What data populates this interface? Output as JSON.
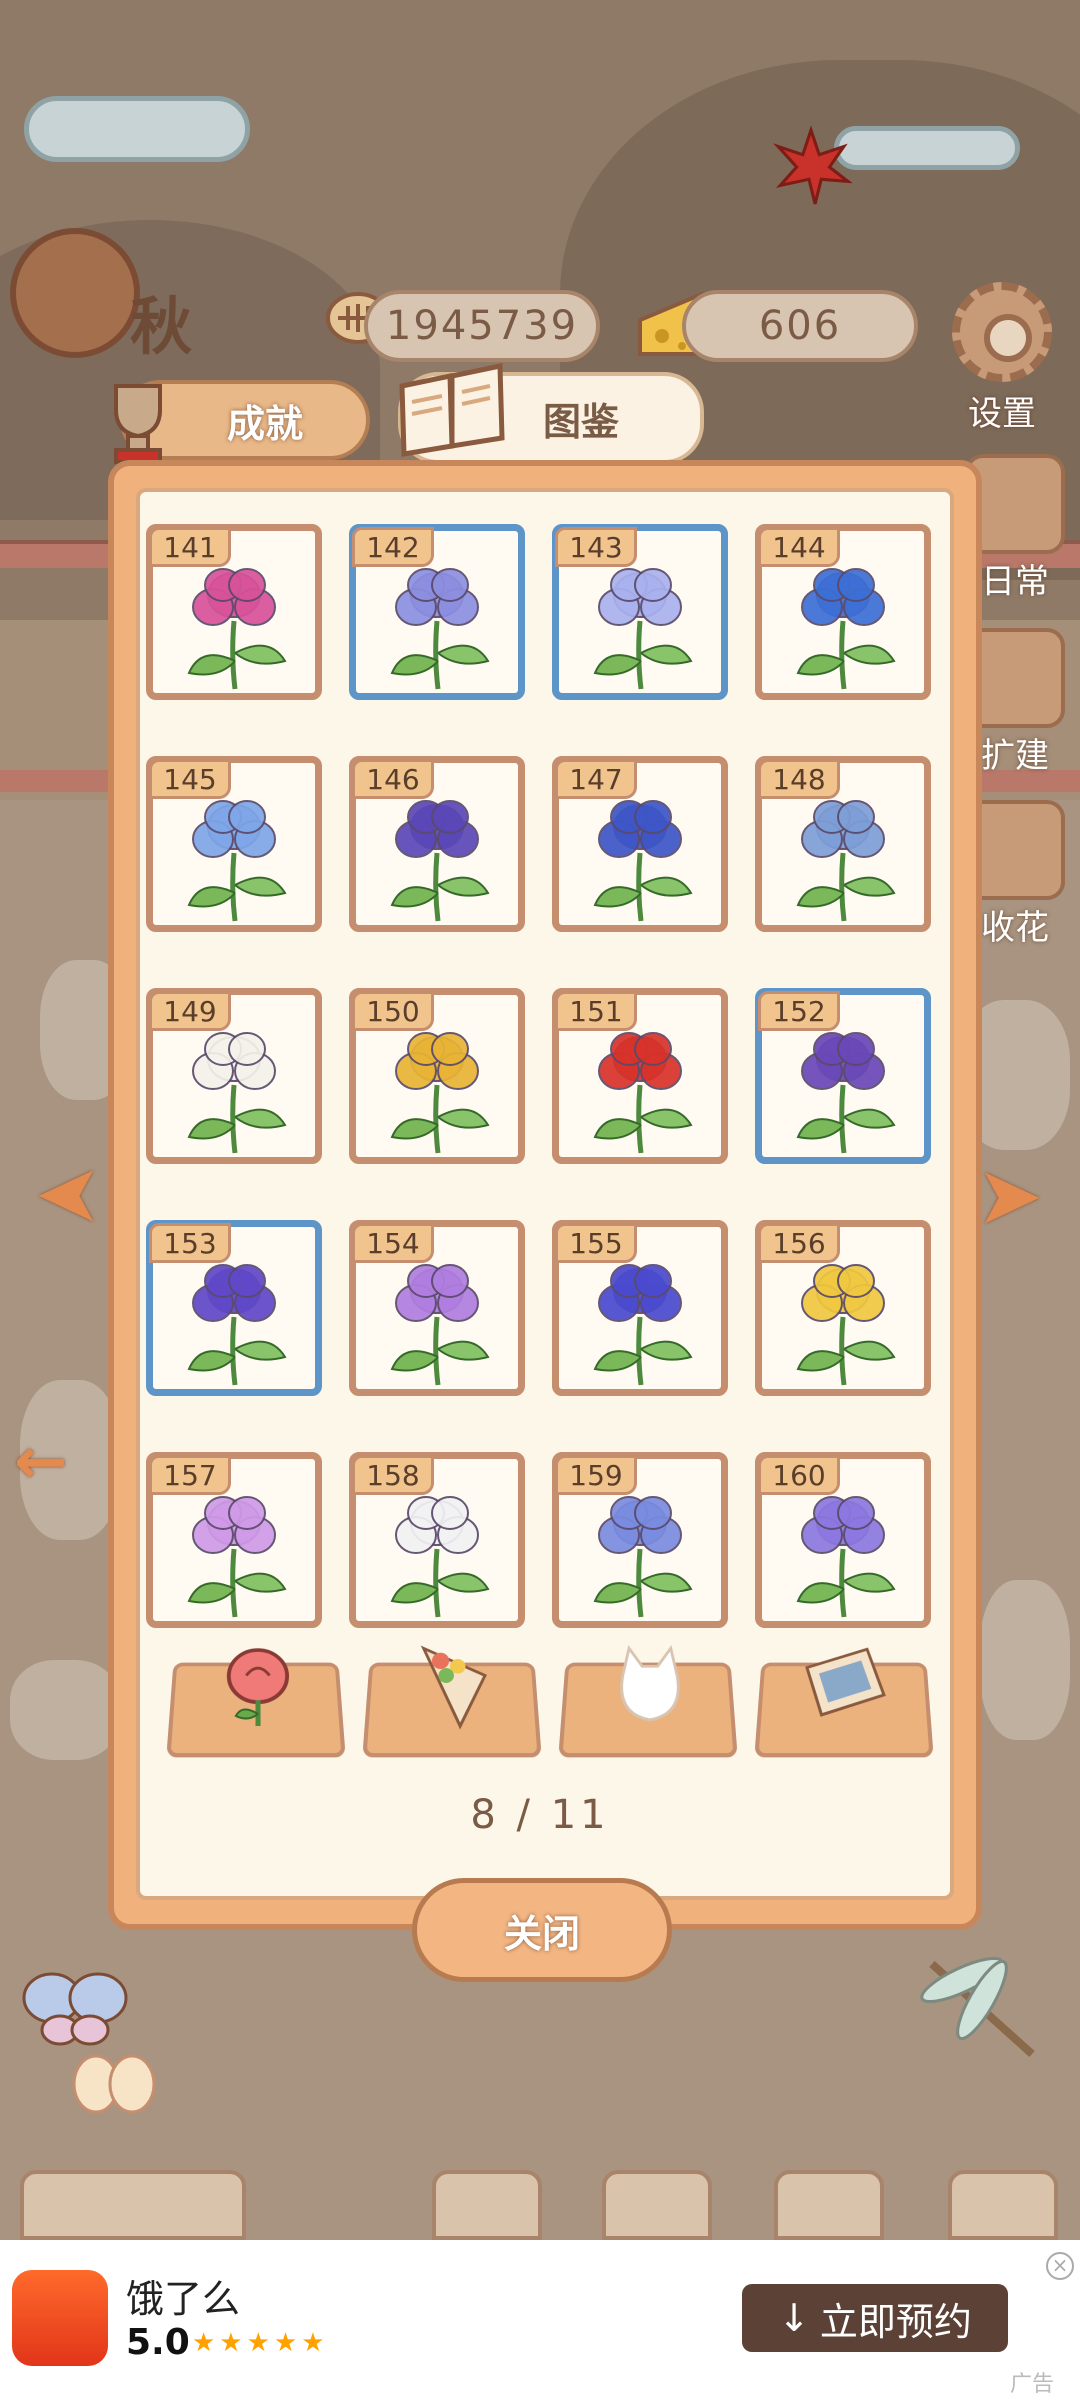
{
  "top": {
    "season_label": "秋",
    "fish_count": "1945739",
    "cheese_count": "606",
    "settings_label": "设置"
  },
  "side": [
    "日常",
    "扩建",
    "收花"
  ],
  "tabs": {
    "achievements": "成就",
    "codex": "图鉴"
  },
  "cards": [
    {
      "num": "141",
      "frame": "brown",
      "color": "#d8529a"
    },
    {
      "num": "142",
      "frame": "blue",
      "color": "#8c8fe0"
    },
    {
      "num": "143",
      "frame": "blue",
      "color": "#a9b2ee"
    },
    {
      "num": "144",
      "frame": "brown",
      "color": "#3c6fd6"
    },
    {
      "num": "145",
      "frame": "brown",
      "color": "#7ea6e8"
    },
    {
      "num": "146",
      "frame": "brown",
      "color": "#5b47b8"
    },
    {
      "num": "147",
      "frame": "brown",
      "color": "#3d56c8"
    },
    {
      "num": "148",
      "frame": "brown",
      "color": "#7e9ed8"
    },
    {
      "num": "149",
      "frame": "brown",
      "color": "#f4f2ea"
    },
    {
      "num": "150",
      "frame": "brown",
      "color": "#e9b435"
    },
    {
      "num": "151",
      "frame": "brown",
      "color": "#d8322a"
    },
    {
      "num": "152",
      "frame": "blue",
      "color": "#6a48b8"
    },
    {
      "num": "153",
      "frame": "blue",
      "color": "#6048c8"
    },
    {
      "num": "154",
      "frame": "brown",
      "color": "#b07ee0"
    },
    {
      "num": "155",
      "frame": "brown",
      "color": "#4a4ad0"
    },
    {
      "num": "156",
      "frame": "brown",
      "color": "#f0c840"
    },
    {
      "num": "157",
      "frame": "brown",
      "color": "#d09ae8"
    },
    {
      "num": "158",
      "frame": "brown",
      "color": "#f2f2f4"
    },
    {
      "num": "159",
      "frame": "brown",
      "color": "#7a8ce0"
    },
    {
      "num": "160",
      "frame": "brown",
      "color": "#8c78e0"
    }
  ],
  "categories": [
    "rose-icon",
    "bouquet-icon",
    "cat-silhouette-icon",
    "postcard-icon"
  ],
  "pagination": "8 / 11",
  "close_label": "关闭",
  "ad": {
    "app_name": "饿了么",
    "rating": "5.0",
    "stars": "★★★★★",
    "cta": "立即预约",
    "label": "广告"
  }
}
